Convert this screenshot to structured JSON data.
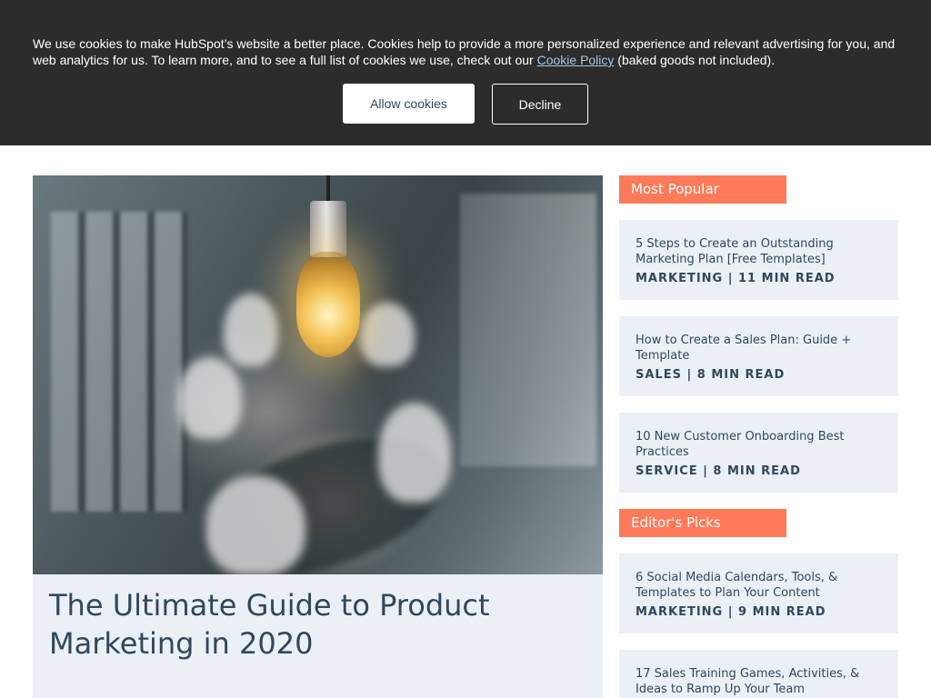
{
  "cookie_banner": {
    "text_before_link": "We use cookies to make HubSpot’s website a better place. Cookies help to provide a more personalized experience and relevant advertising for you, and web analytics for us. To learn more, and to see a full list of cookies we use, check out our ",
    "link_text": "Cookie Policy",
    "text_after_link": " (baked goods not included).",
    "allow_label": "Allow cookies",
    "decline_label": "Decline"
  },
  "featured": {
    "title": "The Ultimate Guide to Product Marketing in 2020"
  },
  "sidebar": {
    "most_popular": {
      "heading": "Most Popular",
      "items": [
        {
          "title": "5 Steps to Create an Outstanding Marketing Plan [Free Templates]",
          "meta": "MARKETING | 11 MIN READ"
        },
        {
          "title": "How to Create a Sales Plan: Guide + Template",
          "meta": "SALES | 8 MIN READ"
        },
        {
          "title": "10 New Customer Onboarding Best Practices",
          "meta": "SERVICE | 8 MIN READ"
        }
      ]
    },
    "editors_picks": {
      "heading": "Editor's Picks",
      "items": [
        {
          "title": "6 Social Media Calendars, Tools, & Templates to Plan Your Content",
          "meta": "MARKETING | 9 MIN READ"
        },
        {
          "title": "17 Sales Training Games, Activities, & Ideas to Ramp Up Your Team",
          "meta": ""
        }
      ]
    }
  },
  "colors": {
    "banner_bg": "#2c2c2c",
    "accent": "#ff7a59",
    "card_bg": "#eaf0f6",
    "text": "#33475b"
  }
}
